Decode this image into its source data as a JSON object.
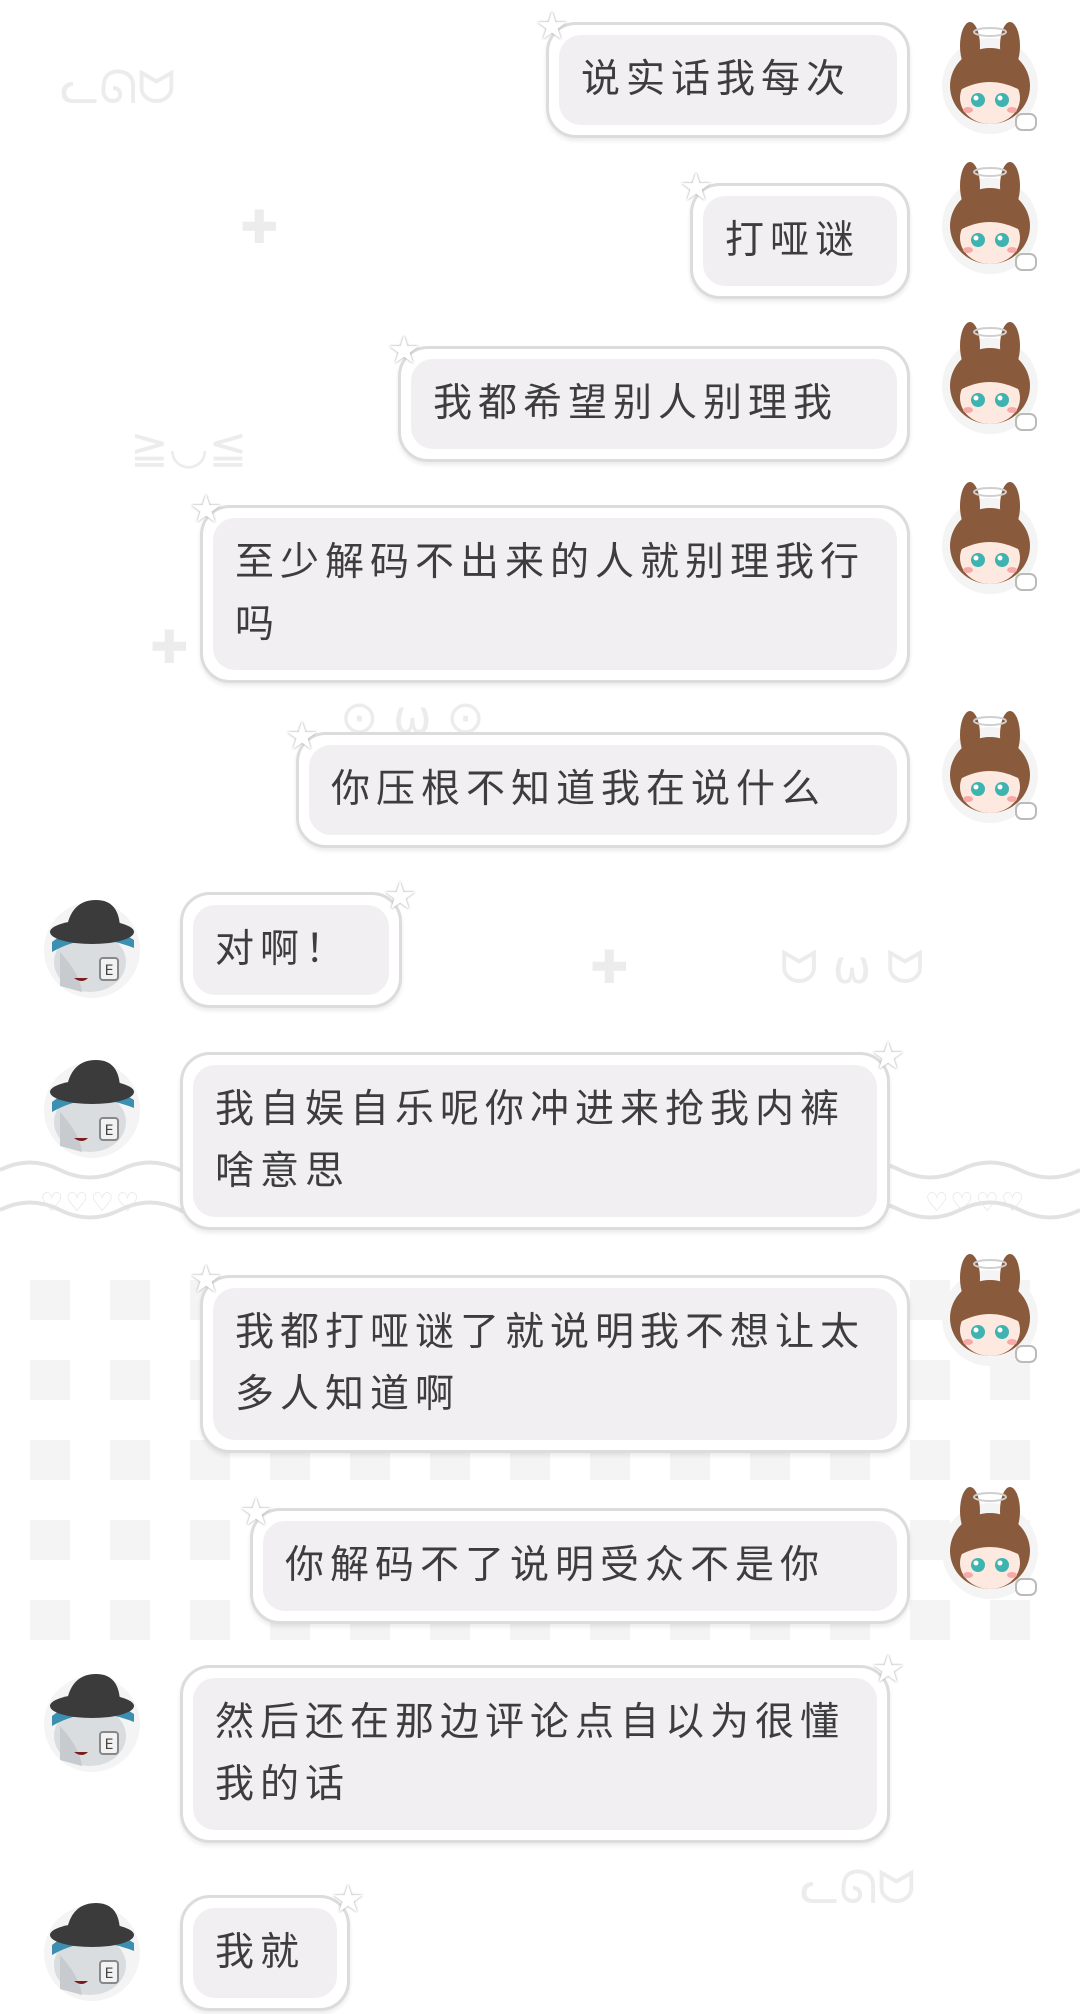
{
  "messages": [
    {
      "side": "right",
      "avatar": "bunny-girl-avatar",
      "text": "说实话我每次"
    },
    {
      "side": "right",
      "avatar": "bunny-girl-avatar",
      "text": "打哑谜"
    },
    {
      "side": "right",
      "avatar": "bunny-girl-avatar",
      "text": "我都希望别人别理我"
    },
    {
      "side": "right",
      "avatar": "bunny-girl-avatar",
      "text": "至少解码不出来的人就别理我行吗"
    },
    {
      "side": "right",
      "avatar": "bunny-girl-avatar",
      "text": "你压根不知道我在说什么"
    },
    {
      "side": "left",
      "avatar": "hat-boy-avatar",
      "text": "对啊！"
    },
    {
      "side": "left",
      "avatar": "hat-boy-avatar",
      "text": "我自娱自乐呢你冲进来抢我内裤啥意思"
    },
    {
      "side": "right",
      "avatar": "bunny-girl-avatar",
      "text": "我都打哑谜了就说明我不想让太多人知道啊"
    },
    {
      "side": "right",
      "avatar": "bunny-girl-avatar",
      "text": "你解码不了说明受众不是你"
    },
    {
      "side": "left",
      "avatar": "hat-boy-avatar",
      "text": "然后还在那边评论点自以为很懂我的话"
    },
    {
      "side": "left",
      "avatar": "hat-boy-avatar",
      "text": "我就"
    }
  ],
  "colors": {
    "bubble_border": "#dcdcdc",
    "bubble_fill": "#f1eff2",
    "text": "#3d3d3d",
    "bunny_hair": "#8a5a3c",
    "bunny_eye": "#3fb3b0",
    "hat": "#3b3b3b",
    "hat_band": "#3b8fb0"
  }
}
